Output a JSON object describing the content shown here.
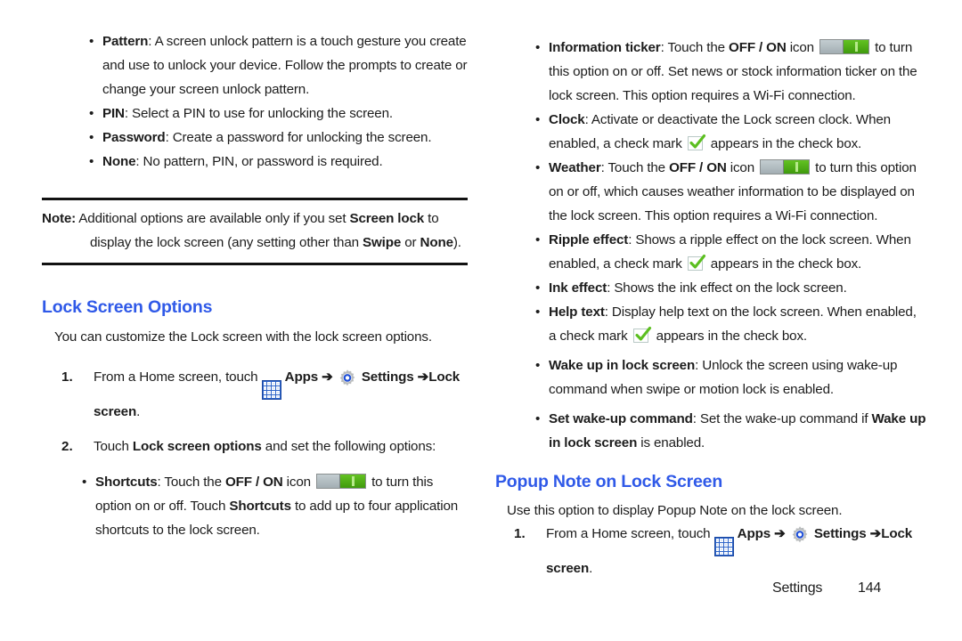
{
  "page": {
    "footer_label": "Settings",
    "footer_page": "144",
    "accent_color": "#2f59e8",
    "toggle_on_color": "#5cbf20",
    "toggle_off_color": "#aeb9bd",
    "check_color": "#5cbf20"
  },
  "left_column": {
    "screen_lock_bullets": [
      {
        "term": "Pattern",
        "rest": ": A screen unlock pattern is a touch gesture you create and use to unlock your device. Follow the prompts to create or change your screen unlock pattern."
      },
      {
        "term": "PIN",
        "rest": ": Select a PIN to use for unlocking the screen."
      },
      {
        "term": "Password",
        "rest": ": Create a password for unlocking the screen."
      },
      {
        "term": "None",
        "rest": ": No pattern, PIN, or password is required."
      }
    ],
    "note": {
      "label": "Note:",
      "part1": " Additional options are available only if you set ",
      "bold1": "Screen lock",
      "part2": " to display the lock screen (any setting other than ",
      "bold2": "Swipe",
      "part3": " or ",
      "bold3": "None",
      "part4": ")."
    },
    "section_heading": "Lock Screen Options",
    "intro": "You can customize the Lock screen with the lock screen options.",
    "steps": [
      {
        "num": "1.",
        "pre": "From a Home screen, touch ",
        "apps_label": "Apps",
        "arrow1": "➔",
        "settings_label": "Settings",
        "arrow2": "➔",
        "target": "Lock screen",
        "period": "."
      },
      {
        "num": "2.",
        "pre": "Touch ",
        "bold": "Lock screen options",
        "post": " and set the following options:"
      }
    ],
    "option_bullets": [
      {
        "term": "Shortcuts",
        "seg1": ": Touch the ",
        "bold_offon": "OFF / ON",
        "seg2": " icon ",
        "icon": "toggle",
        "seg3": " to turn this option on or off. Touch ",
        "bold2": "Shortcuts",
        "seg4": " to add up to four application shortcuts to the lock screen."
      }
    ]
  },
  "right_column": {
    "option_bullets": [
      {
        "term": "Information ticker",
        "seg1": ": Touch the ",
        "bold_offon": "OFF / ON",
        "seg2": " icon ",
        "icon": "toggle",
        "seg3": " to turn this option on or off. Set news or stock information ticker on the lock screen. This option requires a Wi-Fi connection."
      },
      {
        "term": "Clock",
        "seg1": ": Activate or deactivate the Lock screen clock. When enabled, a check mark ",
        "icon": "check",
        "seg3": " appears in the check box."
      },
      {
        "term": "Weather",
        "seg1": ": Touch the ",
        "bold_offon": "OFF / ON",
        "seg2": " icon ",
        "icon": "toggle",
        "seg3": " to turn this option on or off, which causes weather information to be displayed on the lock screen. This option requires a Wi-Fi connection."
      },
      {
        "term": "Ripple effect",
        "seg1": ": Shows a ripple effect on the lock screen. When enabled, a check mark ",
        "icon": "check",
        "seg3": " appears in the check box."
      },
      {
        "term": "Ink effect",
        "seg1": ": Shows the ink effect on the lock screen.",
        "icon": "none",
        "seg3": ""
      },
      {
        "term": "Help text",
        "seg1": ": Display help text on the lock screen. When enabled, a check mark ",
        "icon": "check",
        "seg3": " appears in the check box."
      },
      {
        "term": "Wake up in lock screen",
        "seg1": ": Unlock the screen using wake-up command when swipe or motion lock is enabled.",
        "icon": "none",
        "seg3": ""
      }
    ],
    "set_wake_bullet": {
      "term": "Set wake-up command",
      "seg1": ": Set the wake-up command if ",
      "bold2": "Wake up in lock screen",
      "seg2": " is enabled."
    },
    "section_heading": "Popup Note on Lock Screen",
    "intro": "Use this option to display Popup Note on the lock screen.",
    "steps": [
      {
        "num": "1.",
        "pre": "From a Home screen, touch ",
        "apps_label": "Apps",
        "arrow1": "➔",
        "settings_label": "Settings",
        "arrow2": "➔",
        "target": "Lock screen",
        "period": "."
      }
    ]
  }
}
